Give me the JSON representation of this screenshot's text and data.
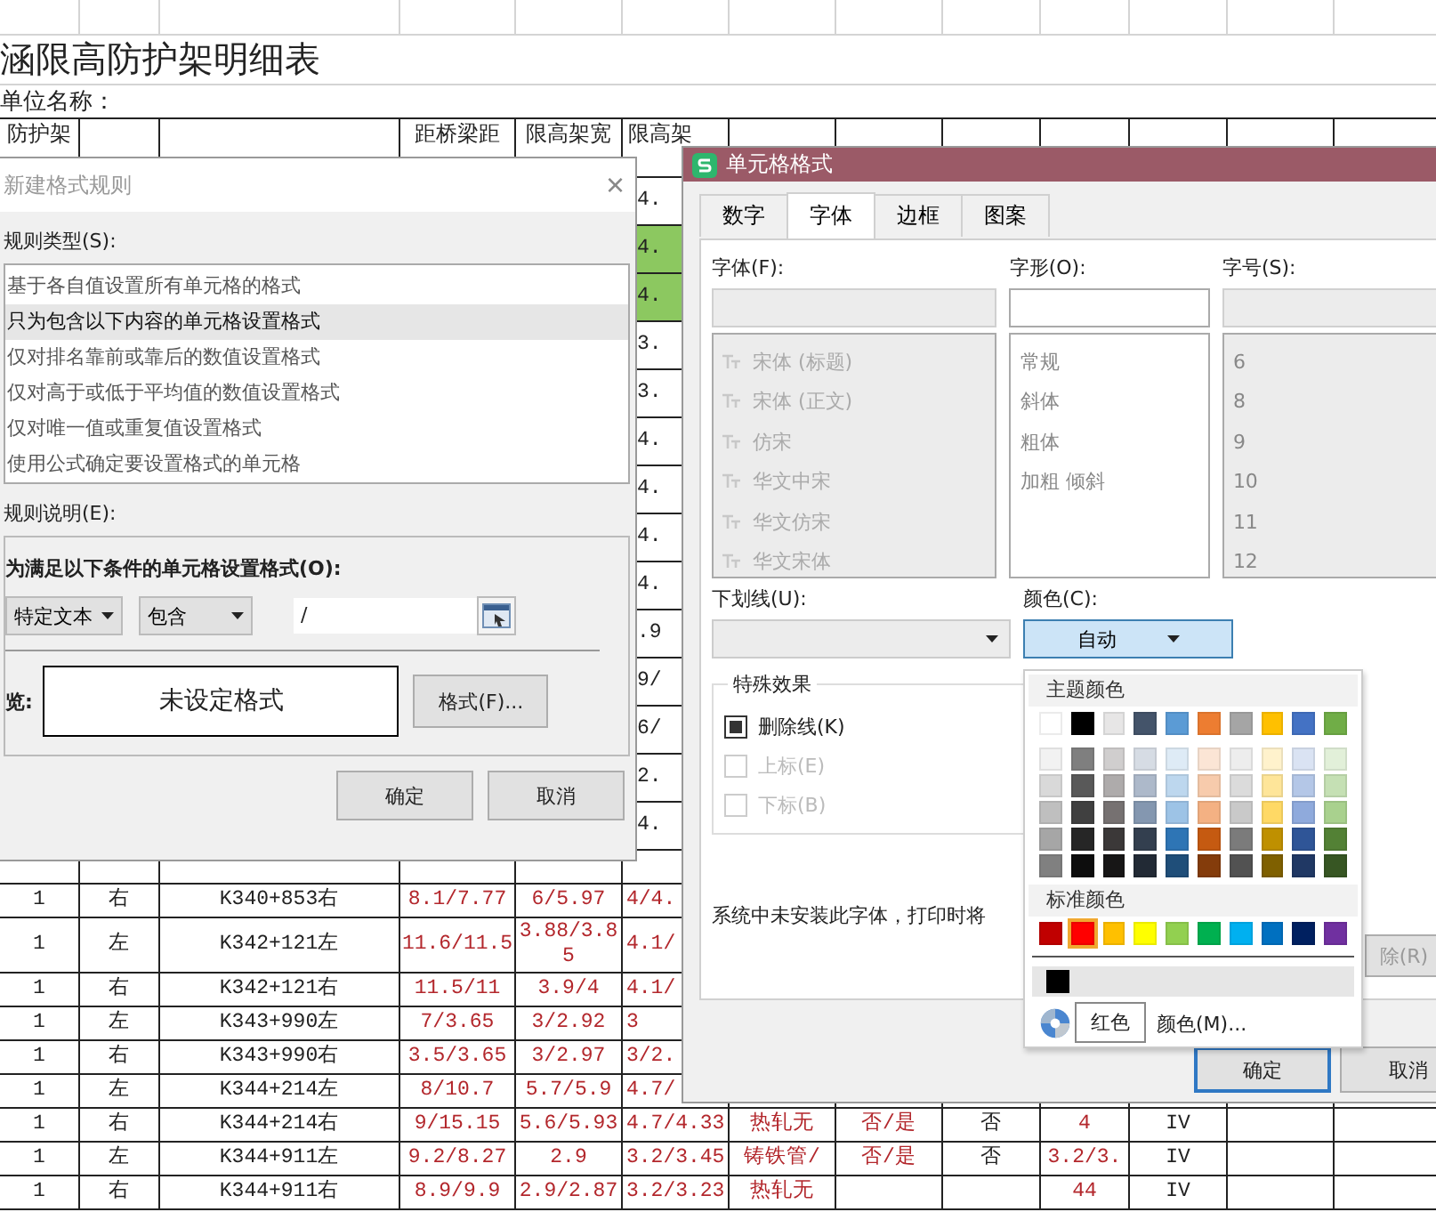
{
  "sheet": {
    "title": "涵限高防护架明细表",
    "unit_label": "单位名称：",
    "header": {
      "column_1": "防护架",
      "column_4": "距桥梁距",
      "column_5": "限高架宽",
      "column_6": "限高架"
    },
    "strip_rows": [
      {
        "column_6": "4.",
        "highlighted": false
      },
      {
        "column_6": "4.",
        "highlighted": true
      },
      {
        "column_6": "4.",
        "highlighted": true
      },
      {
        "column_6": "3.",
        "highlighted": false
      },
      {
        "column_6": "3.",
        "highlighted": false
      },
      {
        "column_6": "4.",
        "highlighted": false
      },
      {
        "column_6": "4.",
        "highlighted": false
      },
      {
        "column_6": "4.",
        "highlighted": false
      },
      {
        "column_6": "4.",
        "highlighted": false
      },
      {
        "column_6": ".9",
        "highlighted": false
      },
      {
        "column_6": "9/",
        "highlighted": false
      },
      {
        "column_6": "6/",
        "highlighted": false
      },
      {
        "column_6": "2.",
        "highlighted": false
      },
      {
        "column_6": "4.",
        "highlighted": false
      }
    ],
    "rows": [
      {
        "column_1": "1",
        "column_2": "右",
        "column_3": "K340+853右",
        "column_4": "8.1/7.77",
        "column_5": "6/5.97",
        "column_6": "4/4."
      },
      {
        "column_1": "1",
        "column_2": "左",
        "column_3": "K342+121左",
        "column_4": "11.6/11.5",
        "column_5": "3.88/3.85",
        "column_6": "4.1/"
      },
      {
        "column_1": "1",
        "column_2": "右",
        "column_3": "K342+121右",
        "column_4": "11.5/11",
        "column_5": "3.9/4",
        "column_6": "4.1/"
      },
      {
        "column_1": "1",
        "column_2": "左",
        "column_3": "K343+990左",
        "column_4": "7/3.65",
        "column_5": "3/2.92",
        "column_6": "3"
      },
      {
        "column_1": "1",
        "column_2": "右",
        "column_3": "K343+990右",
        "column_4": "3.5/3.65",
        "column_5": "3/2.97",
        "column_6": "3/2."
      },
      {
        "column_1": "1",
        "column_2": "左",
        "column_3": "K344+214左",
        "column_4": "8/10.7",
        "column_5": "5.7/5.9",
        "column_6": "4.7/"
      },
      {
        "column_1": "1",
        "column_2": "右",
        "column_3": "K344+214右",
        "column_4": "9/15.15",
        "column_5": "5.6/5.93",
        "column_6": "4.7/4.33",
        "column_7": "热轧无",
        "column_8": "否/是",
        "column_9": "否",
        "column_10": "4",
        "column_11": "IV"
      },
      {
        "column_1": "1",
        "column_2": "左",
        "column_3": "K344+911左",
        "column_4": "9.2/8.27",
        "column_5": "2.9",
        "column_6": "3.2/3.45",
        "column_7": "铸铁管/",
        "column_8": "否/是",
        "column_9": "否",
        "column_10": "3.2/3.",
        "column_11": "IV"
      },
      {
        "column_1": "1",
        "column_2": "右",
        "column_3": "K344+911右",
        "column_4": "8.9/9.9",
        "column_5": "2.9/2.87",
        "column_6": "3.2/3.23",
        "column_7": "热轧无",
        "column_10": "44",
        "column_11": "IV"
      }
    ]
  },
  "rule_dialog": {
    "title": "新建格式规则",
    "close": "×",
    "type_label": "规则类型(S):",
    "rule_types": [
      {
        "label": "基于各自值设置所有单元格的格式",
        "selected": false
      },
      {
        "label": "只为包含以下内容的单元格设置格式",
        "selected": true
      },
      {
        "label": "仅对排名靠前或靠后的数值设置格式",
        "selected": false
      },
      {
        "label": "仅对高于或低于平均值的数值设置格式",
        "selected": false
      },
      {
        "label": "仅对唯一值或重复值设置格式",
        "selected": false
      },
      {
        "label": "使用公式确定要设置格式的单元格",
        "selected": false
      }
    ],
    "desc_label": "规则说明(E):",
    "condition_label": "为满足以下条件的单元格设置格式(O):",
    "condition_type": "特定文本",
    "operator": "包含",
    "value": "/",
    "preview_label": "览:",
    "preview": "未设定格式",
    "format_button": "格式(F)...",
    "buttons": [
      "确定",
      "取消"
    ]
  },
  "format_dialog": {
    "title": "单元格格式",
    "tabs": [
      {
        "label": "数字",
        "selected": false
      },
      {
        "label": "字体",
        "selected": true
      },
      {
        "label": "边框",
        "selected": false
      },
      {
        "label": "图案",
        "selected": false
      }
    ],
    "font_label": "字体(F):",
    "style_label": "字形(O):",
    "size_label": "字号(S):",
    "fonts": [
      "宋体 (标题)",
      "宋体 (正文)",
      "仿宋",
      "华文中宋",
      "华文仿宋",
      "华文宋体"
    ],
    "styles": [
      "常规",
      "斜体",
      "粗体",
      "加粗 倾斜"
    ],
    "sizes": [
      "6",
      "8",
      "9",
      "10",
      "11",
      "12"
    ],
    "underline_label": "下划线(U):",
    "color_label": "颜色(C):",
    "color_value": "自动",
    "effects_label": "特殊效果",
    "effects": [
      {
        "label": "删除线(K)",
        "checked": true,
        "disabled": false
      },
      {
        "label": "上标(E)",
        "checked": false,
        "disabled": true
      },
      {
        "label": "下标(B)",
        "checked": false,
        "disabled": true
      }
    ],
    "message": "系统中未安装此字体，打印时将",
    "clear_button": "除(R)",
    "buttons": [
      "确定",
      "取消"
    ],
    "color_menu": {
      "theme_label": "主题颜色",
      "theme": [
        {
          "color": "#ffffff"
        },
        {
          "color": "#000000"
        },
        {
          "color": "#e7e6e6"
        },
        {
          "color": "#44546a"
        },
        {
          "color": "#5b9bd5"
        },
        {
          "color": "#ed7d31"
        },
        {
          "color": "#a5a5a5"
        },
        {
          "color": "#ffc000"
        },
        {
          "color": "#4472c4"
        },
        {
          "color": "#70ad47"
        }
      ],
      "shades": [
        [
          {
            "color": "#f2f2f2"
          },
          {
            "color": "#7f7f7f"
          },
          {
            "color": "#d0cece"
          },
          {
            "color": "#d6dce4"
          },
          {
            "color": "#deebf6"
          },
          {
            "color": "#fbe5d5"
          },
          {
            "color": "#ededed"
          },
          {
            "color": "#fff2cc"
          },
          {
            "color": "#dae3f3"
          },
          {
            "color": "#e2f0d9"
          }
        ],
        [
          {
            "color": "#d9d9d9"
          },
          {
            "color": "#595959"
          },
          {
            "color": "#aeabab"
          },
          {
            "color": "#adb9ca"
          },
          {
            "color": "#bdd7ee"
          },
          {
            "color": "#f7cbac"
          },
          {
            "color": "#dbdbdb"
          },
          {
            "color": "#fee599"
          },
          {
            "color": "#b4c7e7"
          },
          {
            "color": "#c5e0b4"
          }
        ],
        [
          {
            "color": "#bfbfbf"
          },
          {
            "color": "#404040"
          },
          {
            "color": "#767171"
          },
          {
            "color": "#8497b0"
          },
          {
            "color": "#9dc3e6"
          },
          {
            "color": "#f4b183"
          },
          {
            "color": "#c9c9c9"
          },
          {
            "color": "#ffd965"
          },
          {
            "color": "#8faadc"
          },
          {
            "color": "#a9d18e"
          }
        ],
        [
          {
            "color": "#a6a6a6"
          },
          {
            "color": "#262626"
          },
          {
            "color": "#3b3838"
          },
          {
            "color": "#333f4f"
          },
          {
            "color": "#2e75b5"
          },
          {
            "color": "#c55a11"
          },
          {
            "color": "#7b7b7b"
          },
          {
            "color": "#bf9000"
          },
          {
            "color": "#2f5597"
          },
          {
            "color": "#538135"
          }
        ],
        [
          {
            "color": "#808080"
          },
          {
            "color": "#0d0d0d"
          },
          {
            "color": "#171616"
          },
          {
            "color": "#222a35"
          },
          {
            "color": "#1f4e79"
          },
          {
            "color": "#843c0b"
          },
          {
            "color": "#525252"
          },
          {
            "color": "#7f6000"
          },
          {
            "color": "#203864"
          },
          {
            "color": "#375623"
          }
        ]
      ],
      "standard_label": "标准颜色",
      "standard": [
        {
          "color": "#c00000",
          "selected": false
        },
        {
          "color": "#ff0000",
          "selected": true
        },
        {
          "color": "#ffc000",
          "selected": false
        },
        {
          "color": "#ffff00",
          "selected": false
        },
        {
          "color": "#92d050",
          "selected": false
        },
        {
          "color": "#00b050",
          "selected": false
        },
        {
          "color": "#00b0f0",
          "selected": false
        },
        {
          "color": "#0070c0",
          "selected": false
        },
        {
          "color": "#002060",
          "selected": false
        },
        {
          "color": "#7030a0",
          "selected": false
        }
      ],
      "recent": [
        {
          "color": "#000000"
        }
      ],
      "more": "颜色(M)...",
      "tooltip": "红色"
    }
  }
}
